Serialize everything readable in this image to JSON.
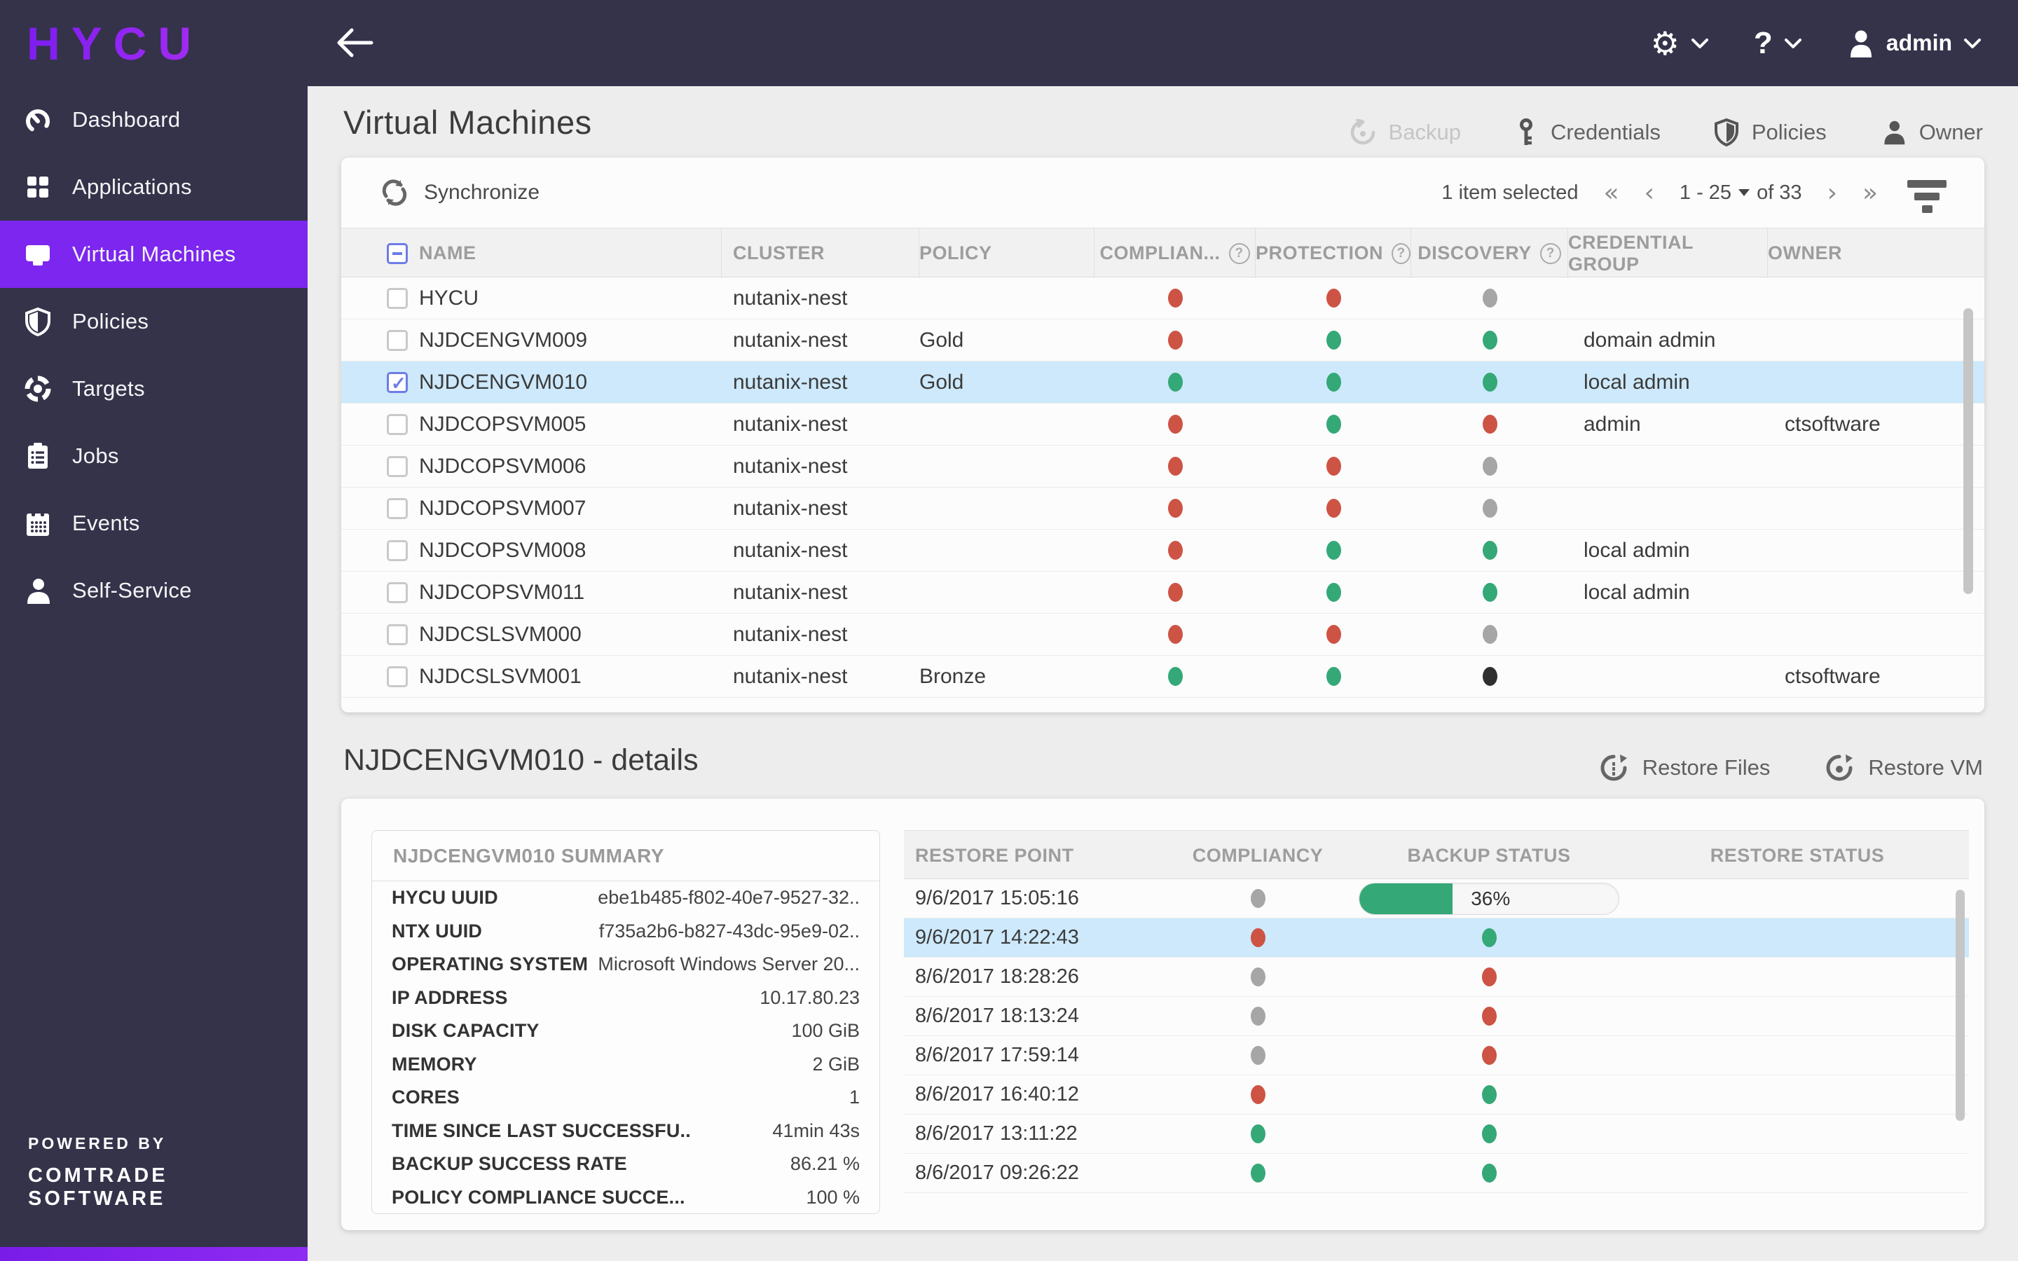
{
  "topbar": {
    "logo": "HYCU",
    "help_label": "?",
    "user_label": "admin"
  },
  "sidebar": {
    "items": [
      {
        "label": "Dashboard"
      },
      {
        "label": "Applications"
      },
      {
        "label": "Virtual Machines"
      },
      {
        "label": "Policies"
      },
      {
        "label": "Targets"
      },
      {
        "label": "Jobs"
      },
      {
        "label": "Events"
      },
      {
        "label": "Self-Service"
      }
    ],
    "powered_by": "POWERED BY",
    "company": "COMTRADE SOFTWARE"
  },
  "page": {
    "title": "Virtual Machines",
    "toolbar": {
      "backup": "Backup",
      "credentials": "Credentials",
      "policies": "Policies",
      "owner": "Owner"
    }
  },
  "vm_table": {
    "synchronize_label": "Synchronize",
    "selection_status": "1 item selected",
    "pagination": {
      "range": "1 - 25",
      "of_label": "of 33",
      "prev_all": "«",
      "prev": "‹",
      "next": "›",
      "next_all": "»"
    },
    "columns": [
      "NAME",
      "CLUSTER",
      "POLICY",
      "COMPLIAN...",
      "PROTECTION",
      "DISCOVERY",
      "CREDENTIAL GROUP",
      "OWNER"
    ],
    "rows": [
      {
        "name": "HYCU",
        "cluster": "nutanix-nest",
        "policy": "",
        "compliance": "red",
        "protection": "red",
        "discovery": "gray",
        "credential_group": "",
        "owner": "",
        "checked": false,
        "selected": false
      },
      {
        "name": "NJDCENGVM009",
        "cluster": "nutanix-nest",
        "policy": "Gold",
        "compliance": "red",
        "protection": "green",
        "discovery": "green",
        "credential_group": "domain admin",
        "owner": "",
        "checked": false,
        "selected": false
      },
      {
        "name": "NJDCENGVM010",
        "cluster": "nutanix-nest",
        "policy": "Gold",
        "compliance": "green",
        "protection": "green",
        "discovery": "green",
        "credential_group": "local admin",
        "owner": "",
        "checked": true,
        "selected": true
      },
      {
        "name": "NJDCOPSVM005",
        "cluster": "nutanix-nest",
        "policy": "",
        "compliance": "red",
        "protection": "green",
        "discovery": "red",
        "credential_group": "admin",
        "owner": "ctsoftware",
        "checked": false,
        "selected": false
      },
      {
        "name": "NJDCOPSVM006",
        "cluster": "nutanix-nest",
        "policy": "",
        "compliance": "red",
        "protection": "red",
        "discovery": "gray",
        "credential_group": "",
        "owner": "",
        "checked": false,
        "selected": false
      },
      {
        "name": "NJDCOPSVM007",
        "cluster": "nutanix-nest",
        "policy": "",
        "compliance": "red",
        "protection": "red",
        "discovery": "gray",
        "credential_group": "",
        "owner": "",
        "checked": false,
        "selected": false
      },
      {
        "name": "NJDCOPSVM008",
        "cluster": "nutanix-nest",
        "policy": "",
        "compliance": "red",
        "protection": "green",
        "discovery": "green",
        "credential_group": "local admin",
        "owner": "",
        "checked": false,
        "selected": false
      },
      {
        "name": "NJDCOPSVM011",
        "cluster": "nutanix-nest",
        "policy": "",
        "compliance": "red",
        "protection": "green",
        "discovery": "green",
        "credential_group": "local admin",
        "owner": "",
        "checked": false,
        "selected": false
      },
      {
        "name": "NJDCSLSVM000",
        "cluster": "nutanix-nest",
        "policy": "",
        "compliance": "red",
        "protection": "red",
        "discovery": "gray",
        "credential_group": "",
        "owner": "",
        "checked": false,
        "selected": false
      },
      {
        "name": "NJDCSLSVM001",
        "cluster": "nutanix-nest",
        "policy": "Bronze",
        "compliance": "green",
        "protection": "green",
        "discovery": "black",
        "credential_group": "",
        "owner": "ctsoftware",
        "checked": false,
        "selected": false
      }
    ]
  },
  "details": {
    "title": "NJDCENGVM010 - details",
    "restore_files_label": "Restore Files",
    "restore_vm_label": "Restore VM",
    "summary": {
      "header": "NJDCENGVM010 SUMMARY",
      "rows": [
        {
          "label": "HYCU UUID",
          "value": "ebe1b485-f802-40e7-9527-32.."
        },
        {
          "label": "NTX UUID",
          "value": "f735a2b6-b827-43dc-95e9-02.."
        },
        {
          "label": "OPERATING SYSTEM",
          "value": "Microsoft Windows Server 20..."
        },
        {
          "label": "IP ADDRESS",
          "value": "10.17.80.23"
        },
        {
          "label": "DISK CAPACITY",
          "value": "100 GiB"
        },
        {
          "label": "MEMORY",
          "value": "2 GiB"
        },
        {
          "label": "CORES",
          "value": "1"
        },
        {
          "label": "TIME SINCE LAST SUCCESSFU..",
          "value": "41min 43s"
        },
        {
          "label": "BACKUP SUCCESS RATE",
          "value": "86.21 %"
        },
        {
          "label": "POLICY COMPLIANCE SUCCE...",
          "value": "100 %"
        }
      ]
    },
    "restore_points": {
      "columns": [
        "RESTORE POINT",
        "COMPLIANCY",
        "BACKUP STATUS",
        "RESTORE STATUS"
      ],
      "rows": [
        {
          "time": "9/6/2017 15:05:16",
          "compliancy": "gray",
          "backup": "progress",
          "progress_label": "36%",
          "progress_percent": 36,
          "restore": "",
          "selected": false
        },
        {
          "time": "9/6/2017 14:22:43",
          "compliancy": "red",
          "backup": "green",
          "restore": "",
          "selected": true
        },
        {
          "time": "8/6/2017 18:28:26",
          "compliancy": "gray",
          "backup": "red",
          "restore": "",
          "selected": false
        },
        {
          "time": "8/6/2017 18:13:24",
          "compliancy": "gray",
          "backup": "red",
          "restore": "",
          "selected": false
        },
        {
          "time": "8/6/2017 17:59:14",
          "compliancy": "gray",
          "backup": "red",
          "restore": "",
          "selected": false
        },
        {
          "time": "8/6/2017 16:40:12",
          "compliancy": "red",
          "backup": "green",
          "restore": "",
          "selected": false
        },
        {
          "time": "8/6/2017 13:11:22",
          "compliancy": "green",
          "backup": "green",
          "restore": "",
          "selected": false
        },
        {
          "time": "8/6/2017 09:26:22",
          "compliancy": "green",
          "backup": "green",
          "restore": "",
          "selected": false
        }
      ]
    }
  },
  "colors": {
    "accent": "#7c26ef",
    "green": "#35a877",
    "red": "#cd5344",
    "gray": "#a6a6a6",
    "black": "#2f2f30",
    "selected_row": "#cde9fb"
  }
}
